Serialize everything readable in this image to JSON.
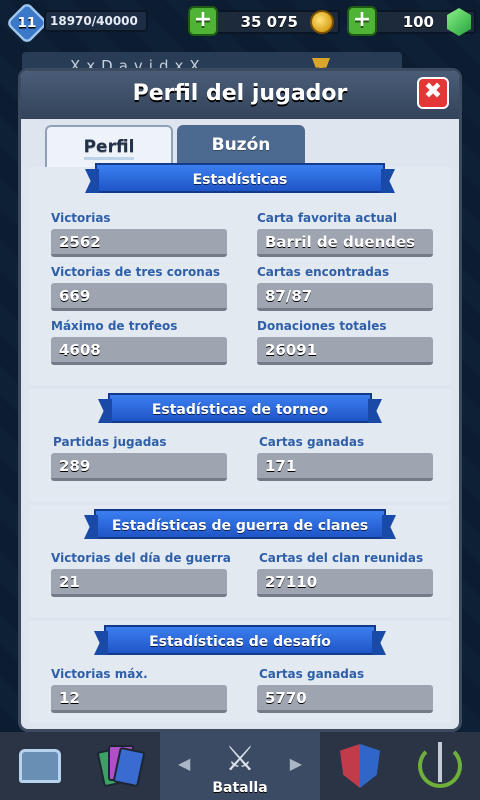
{
  "hud": {
    "level": "11",
    "xp": "18970/40000",
    "gold": "35 075",
    "gems": "100",
    "plus_gold": "+",
    "plus_gems": "+"
  },
  "player_name": "XxDavidxX",
  "panel": {
    "title": "Perfil del jugador",
    "close": "✖",
    "tabs": [
      {
        "label": "Perfil"
      },
      {
        "label": "Buzón"
      }
    ]
  },
  "sections": {
    "general": {
      "title": "Estadísticas",
      "stats": [
        {
          "label": "Victorias",
          "value": "2562"
        },
        {
          "label": "Carta favorita actual",
          "value": "Barril de duendes"
        },
        {
          "label": "Victorias de tres coronas",
          "value": "669"
        },
        {
          "label": "Cartas encontradas",
          "value": "87/87"
        },
        {
          "label": "Máximo de trofeos",
          "value": "4608"
        },
        {
          "label": "Donaciones totales",
          "value": "26091"
        }
      ]
    },
    "tournament": {
      "title": "Estadísticas de torneo",
      "stats": [
        {
          "label": "Partidas jugadas",
          "value": "289"
        },
        {
          "label": "Cartas ganadas",
          "value": "171"
        }
      ]
    },
    "clan_war": {
      "title": "Estadísticas de guerra de clanes",
      "stats": [
        {
          "label": "Victorias del día de guerra",
          "value": "21"
        },
        {
          "label": "Cartas del clan reunidas",
          "value": "27110"
        }
      ]
    },
    "challenge": {
      "title": "Estadísticas de desafío",
      "stats": [
        {
          "label": "Victorias máx.",
          "value": "12"
        },
        {
          "label": "Cartas ganadas",
          "value": "5770"
        }
      ]
    }
  },
  "bottom_nav": {
    "battle_label": "Batalla",
    "arrow_left": "◀",
    "arrow_right": "▶",
    "swords": "⚔"
  }
}
